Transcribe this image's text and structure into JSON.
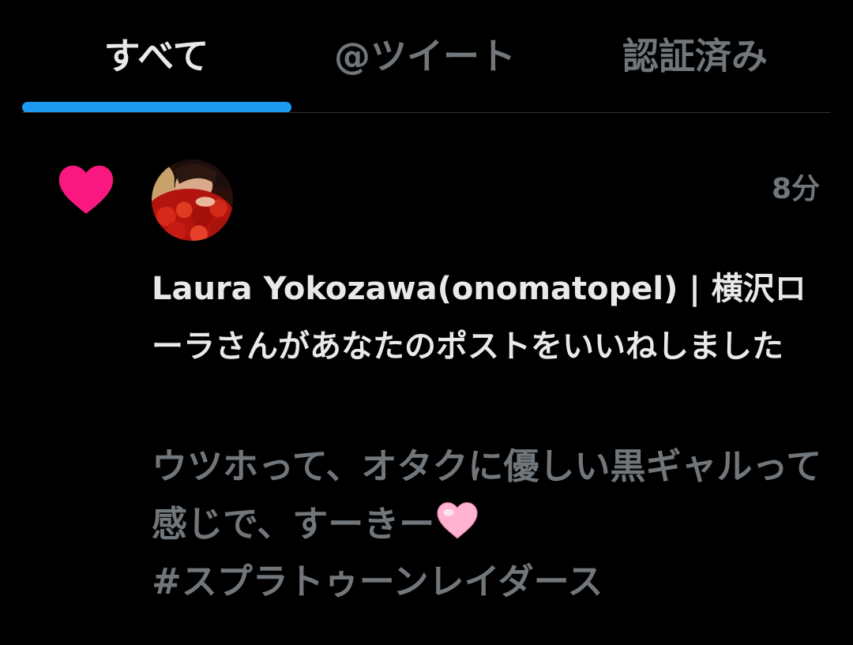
{
  "tabs": {
    "items": [
      {
        "label": "すべて",
        "selected": true
      },
      {
        "label": "@ツイート",
        "selected": false
      },
      {
        "label": "認証済み",
        "selected": false
      }
    ]
  },
  "notification": {
    "type_icon": "heart-icon",
    "avatar_icon": "user-avatar",
    "timestamp": "8分",
    "headline": "Laura Yokozawa(onomatopel) | 横沢ローラさんがあなたのポストをいいねしました",
    "tweet": {
      "text": "ウツホって、オタクに優しい黒ギャルって感じで、すーきー",
      "emoji": "pink-heart-icon",
      "hashtag": "#スプラトゥーンレイダース"
    }
  },
  "colors": {
    "background": "#000000",
    "text_primary": "#e7e9ea",
    "text_secondary": "#71767b",
    "accent": "#1d9bf0",
    "like": "#f91880",
    "emoji_pink": "#ffb3d1"
  }
}
